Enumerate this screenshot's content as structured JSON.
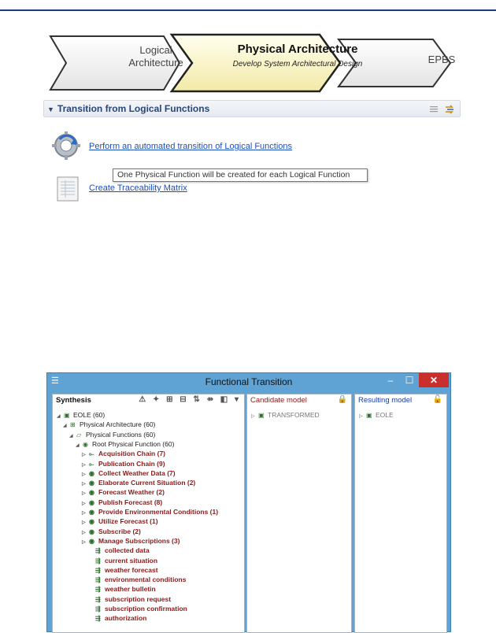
{
  "process": {
    "logical": "Logical\nArchitecture",
    "logical_line1": "Logical",
    "logical_line2": "Architecture",
    "physical_title": "Physical Architecture",
    "physical_sub": "Develop System Architectural Design",
    "epbs": "EPBS"
  },
  "section": {
    "title": "Transition from Logical Functions",
    "actions": [
      {
        "label": "Perform an automated transition of Logical Functions",
        "icon": "gear-icon"
      },
      {
        "label": "Create Traceability Matrix",
        "icon": "document-icon"
      }
    ],
    "tooltip": "One Physical Function will be created for each Logical Function"
  },
  "window": {
    "title": "Functional Transition",
    "panes": {
      "synthesis": {
        "title": "Synthesis",
        "tree": [
          {
            "label": "EOLE (60)",
            "style": "black",
            "level": 0,
            "expander": "open",
            "icon": "model-icon"
          },
          {
            "label": "Physical Architecture (60)",
            "style": "black",
            "level": 1,
            "expander": "open",
            "icon": "architecture-icon"
          },
          {
            "label": "Physical Functions (60)",
            "style": "black",
            "level": 2,
            "expander": "open",
            "icon": "folder-icon"
          },
          {
            "label": "Root Physical Function (60)",
            "style": "black",
            "level": 3,
            "expander": "open",
            "icon": "function-icon"
          },
          {
            "label": "Acquisition Chain (7)",
            "style": "red",
            "level": 4,
            "expander": "closed",
            "icon": "chain-icon"
          },
          {
            "label": "Publication Chain (9)",
            "style": "red",
            "level": 4,
            "expander": "closed",
            "icon": "chain-icon"
          },
          {
            "label": "Collect Weather Data (7)",
            "style": "red",
            "level": 4,
            "expander": "closed",
            "icon": "function-icon"
          },
          {
            "label": "Elaborate Current Situation (2)",
            "style": "red",
            "level": 4,
            "expander": "closed",
            "icon": "function-icon"
          },
          {
            "label": "Forecast Weather (2)",
            "style": "red",
            "level": 4,
            "expander": "closed",
            "icon": "function-icon"
          },
          {
            "label": "Publish Forecast (8)",
            "style": "red",
            "level": 4,
            "expander": "closed",
            "icon": "function-icon"
          },
          {
            "label": "Provide Environmental Conditions (1)",
            "style": "red",
            "level": 4,
            "expander": "closed",
            "icon": "function-icon"
          },
          {
            "label": "Utilize Forecast (1)",
            "style": "red",
            "level": 4,
            "expander": "closed",
            "icon": "function-icon"
          },
          {
            "label": "Subscribe (2)",
            "style": "red",
            "level": 4,
            "expander": "closed",
            "icon": "function-icon"
          },
          {
            "label": "Manage Subscriptions (3)",
            "style": "red",
            "level": 4,
            "expander": "closed",
            "icon": "function-icon"
          },
          {
            "label": "collected data",
            "style": "red",
            "level": 5,
            "expander": "none",
            "icon": "exchange-icon"
          },
          {
            "label": "current situation",
            "style": "red",
            "level": 5,
            "expander": "none",
            "icon": "exchange-icon"
          },
          {
            "label": "weather forecast",
            "style": "red",
            "level": 5,
            "expander": "none",
            "icon": "exchange-icon"
          },
          {
            "label": "environmental conditions",
            "style": "red",
            "level": 5,
            "expander": "none",
            "icon": "exchange-icon"
          },
          {
            "label": "weather bulletin",
            "style": "red",
            "level": 5,
            "expander": "none",
            "icon": "exchange-icon"
          },
          {
            "label": "subscription request",
            "style": "red",
            "level": 5,
            "expander": "none",
            "icon": "exchange-icon"
          },
          {
            "label": "subscription confirmation",
            "style": "red",
            "level": 5,
            "expander": "none",
            "icon": "exchange-icon"
          },
          {
            "label": "authorization",
            "style": "red",
            "level": 5,
            "expander": "none",
            "icon": "exchange-icon"
          }
        ]
      },
      "candidate": {
        "title": "Candidate model",
        "tree": [
          {
            "label": "TRANSFORMED",
            "style": "grey",
            "level": 0,
            "expander": "closed",
            "icon": "model-icon"
          }
        ]
      },
      "result": {
        "title": "Resulting model",
        "tree": [
          {
            "label": "EOLE",
            "style": "grey",
            "level": 0,
            "expander": "closed",
            "icon": "model-icon"
          }
        ]
      }
    }
  },
  "colors": {
    "link": "#1a4fbf",
    "bold_red": "#8b1a1a",
    "titlebar": "#5fa3d4",
    "close": "#c9302c"
  }
}
